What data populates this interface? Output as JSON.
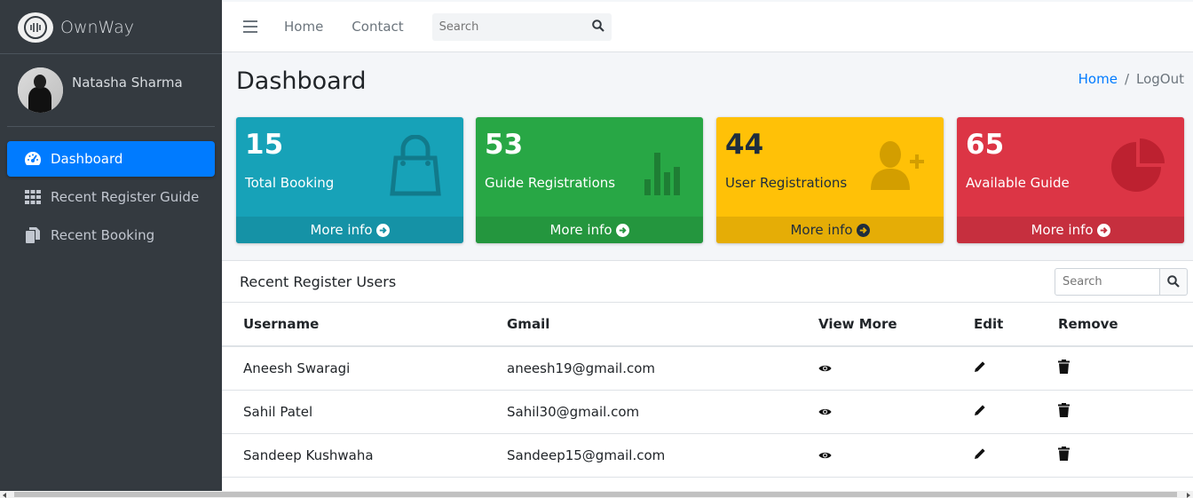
{
  "brand": {
    "name": "OwnWay"
  },
  "user": {
    "name": "Natasha Sharma"
  },
  "sidebar": {
    "items": [
      {
        "label": "Dashboard",
        "icon": "tachometer-icon",
        "active": true
      },
      {
        "label": "Recent Register Guide",
        "icon": "grid-icon",
        "active": false
      },
      {
        "label": "Recent Booking",
        "icon": "copy-icon",
        "active": false
      }
    ]
  },
  "topbar": {
    "links": [
      "Home",
      "Contact"
    ],
    "search_placeholder": "Search"
  },
  "page": {
    "title": "Dashboard",
    "breadcrumb": {
      "home": "Home",
      "separator": "/",
      "current": "LogOut"
    }
  },
  "boxes": [
    {
      "value": "15",
      "label": "Total Booking",
      "footer": "More info",
      "icon": "shopping-bag-icon",
      "color": "#17a2b8"
    },
    {
      "value": "53",
      "label": "Guide Registrations",
      "footer": "More info",
      "icon": "bar-chart-icon",
      "color": "#28a745"
    },
    {
      "value": "44",
      "label": "User Registrations",
      "footer": "More info",
      "icon": "user-plus-icon",
      "color": "#ffc107"
    },
    {
      "value": "65",
      "label": "Available Guide",
      "footer": "More info",
      "icon": "pie-chart-icon",
      "color": "#dc3545"
    }
  ],
  "card": {
    "title": "Recent Register Users",
    "search_placeholder": "Search",
    "columns": [
      "Username",
      "Gmail",
      "View More",
      "Edit",
      "Remove"
    ],
    "rows": [
      {
        "username": "Aneesh Swaragi",
        "gmail": "aneesh19@gmail.com"
      },
      {
        "username": "Sahil Patel",
        "gmail": "Sahil30@gmail.com"
      },
      {
        "username": "Sandeep Kushwaha",
        "gmail": "Sandeep15@gmail.com"
      }
    ]
  },
  "colors": {
    "sidebar_bg": "#343a40",
    "primary": "#007bff"
  }
}
